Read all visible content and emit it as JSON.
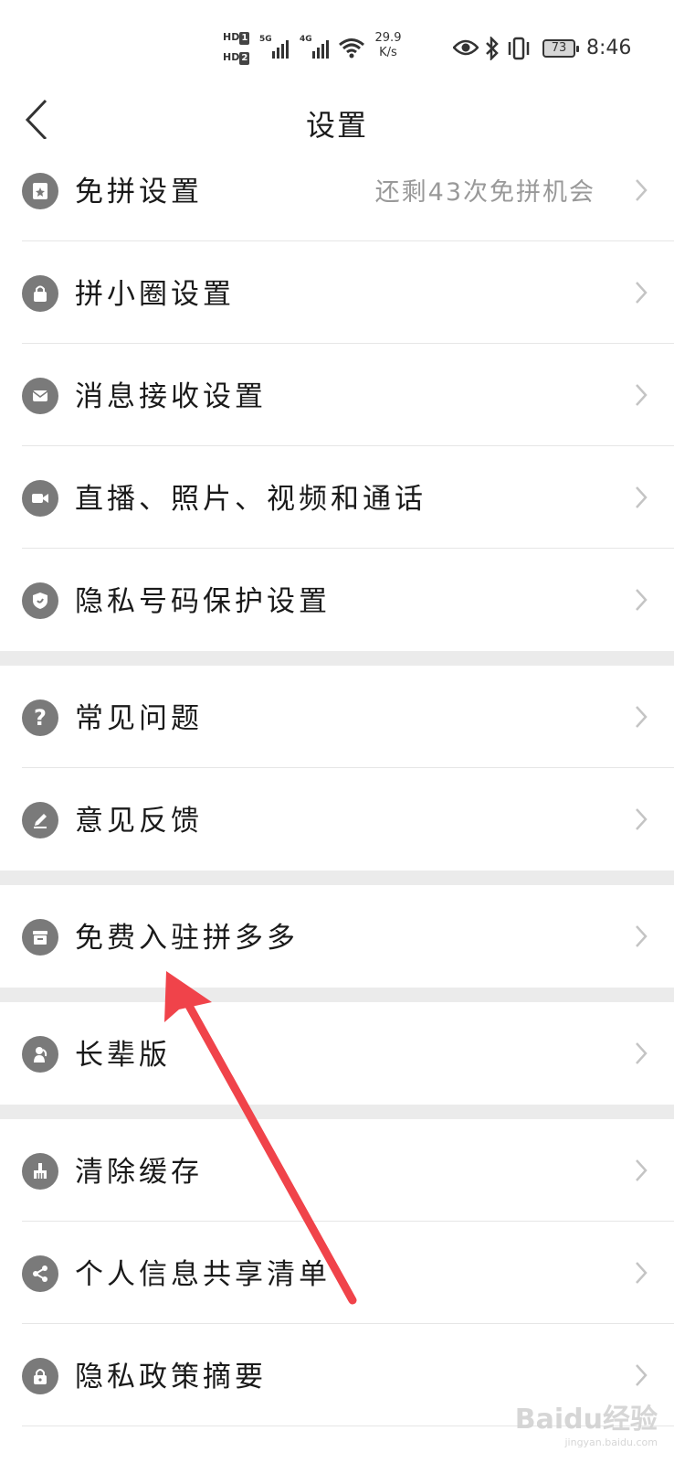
{
  "status_bar": {
    "hd1": "HD",
    "hd1_n": "1",
    "hd2": "HD",
    "hd2_n": "2",
    "net1": "5G",
    "net2": "4G",
    "speed_value": "29.9",
    "speed_unit": "K/s",
    "battery": "73",
    "time": "8:46"
  },
  "header": {
    "title": "设置"
  },
  "sections": [
    {
      "items": [
        {
          "label": "免拼设置",
          "icon": "card-icon",
          "value": "还剩43次免拼机会"
        },
        {
          "label": "拼小圈设置",
          "icon": "bag-icon"
        },
        {
          "label": "消息接收设置",
          "icon": "mail-icon"
        },
        {
          "label": "直播、照片、视频和通话",
          "icon": "video-camera-icon"
        },
        {
          "label": "隐私号码保护设置",
          "icon": "shield-icon"
        }
      ]
    },
    {
      "items": [
        {
          "label": "常见问题",
          "icon": "question-icon"
        },
        {
          "label": "意见反馈",
          "icon": "pencil-icon"
        }
      ]
    },
    {
      "items": [
        {
          "label": "免费入驻拼多多",
          "icon": "store-icon"
        }
      ]
    },
    {
      "items": [
        {
          "label": "长辈版",
          "icon": "elder-icon"
        }
      ]
    },
    {
      "items": [
        {
          "label": "清除缓存",
          "icon": "broom-icon"
        },
        {
          "label": "个人信息共享清单",
          "icon": "share-icon"
        },
        {
          "label": "隐私政策摘要",
          "icon": "lock-icon"
        }
      ]
    }
  ],
  "annotation": {
    "arrow_color": "#f0434a"
  },
  "watermark": {
    "brand": "Baidu经验",
    "url": "jingyan.baidu.com"
  }
}
